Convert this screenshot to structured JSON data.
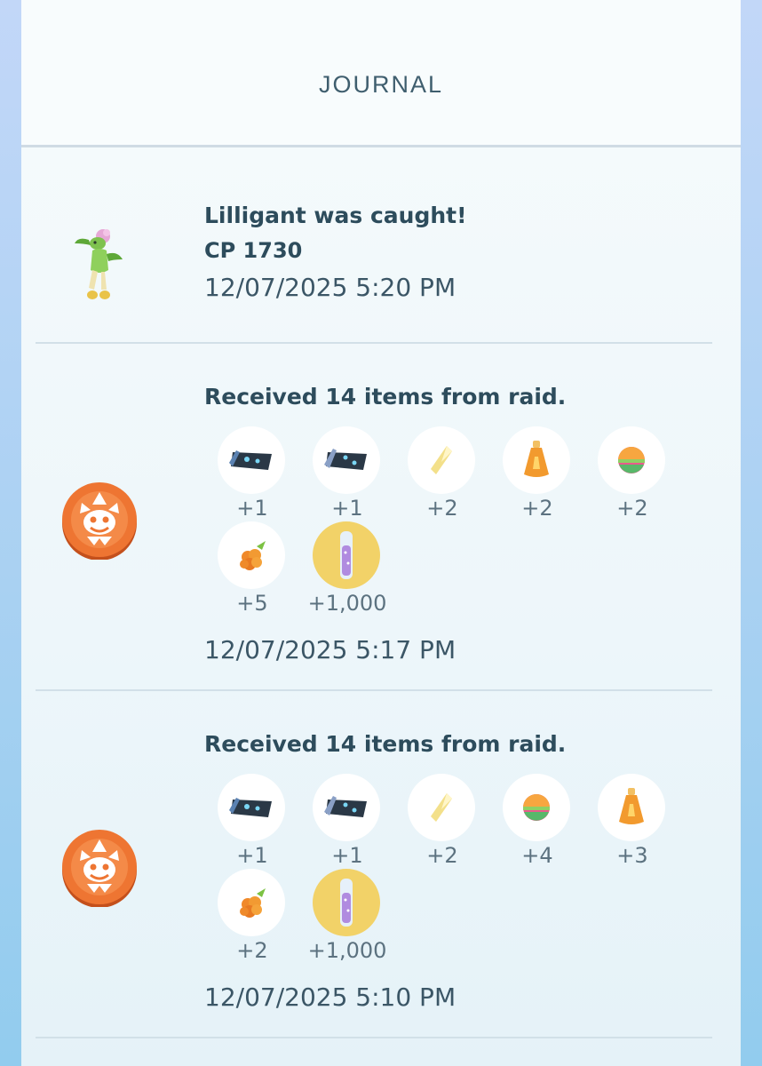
{
  "header": {
    "title": "JOURNAL"
  },
  "entries": [
    {
      "title": "Lilligant was caught!",
      "cp": "CP 1730",
      "time": "12/07/2025 5:20 PM"
    },
    {
      "title": "Received 14 items from raid.",
      "items": [
        {
          "icon": "tm-charged-icon",
          "count": "+1"
        },
        {
          "icon": "tm-fast-icon",
          "count": "+1"
        },
        {
          "icon": "rare-candy-icon",
          "count": "+2"
        },
        {
          "icon": "potion-icon",
          "count": "+2"
        },
        {
          "icon": "ball-icon",
          "count": "+2"
        },
        {
          "icon": "golden-razz-berry-icon",
          "count": "+5"
        },
        {
          "icon": "stardust-icon",
          "count": "+1,000"
        }
      ],
      "time": "12/07/2025 5:17 PM"
    },
    {
      "title": "Received 14 items from raid.",
      "items": [
        {
          "icon": "tm-charged-icon",
          "count": "+1"
        },
        {
          "icon": "tm-fast-icon",
          "count": "+1"
        },
        {
          "icon": "rare-candy-icon",
          "count": "+2"
        },
        {
          "icon": "ball-icon",
          "count": "+4"
        },
        {
          "icon": "potion-icon",
          "count": "+3"
        },
        {
          "icon": "golden-razz-berry-icon",
          "count": "+2"
        },
        {
          "icon": "stardust-icon",
          "count": "+1,000"
        }
      ],
      "time": "12/07/2025 5:10 PM"
    }
  ]
}
